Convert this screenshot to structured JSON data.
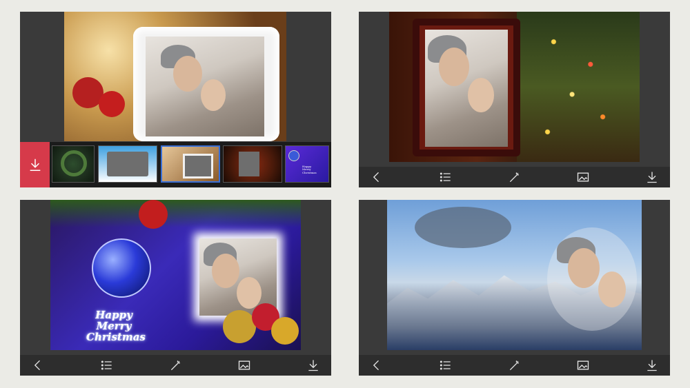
{
  "panels": {
    "p1": {
      "download_icon": "download-icon",
      "thumbnails": [
        "wreath-frame",
        "snow-frame",
        "frost-frame",
        "lights-frame",
        "ornament-frame"
      ],
      "thumb_card_text": "Happy\nMerry\nChristmas"
    },
    "p3": {
      "greeting_line1": "Happy",
      "greeting_line2": "Merry",
      "greeting_line3": "Christmas"
    }
  },
  "toolbar": {
    "icons": [
      "back-icon",
      "list-icon",
      "magic-wand-icon",
      "image-icon",
      "download-icon"
    ]
  },
  "colors": {
    "panel_bg": "#3a3a3a",
    "toolbar_bg": "#2d2d2d",
    "download_accent": "#d63a4a",
    "selected_thumb_border": "#3a6fd6"
  }
}
